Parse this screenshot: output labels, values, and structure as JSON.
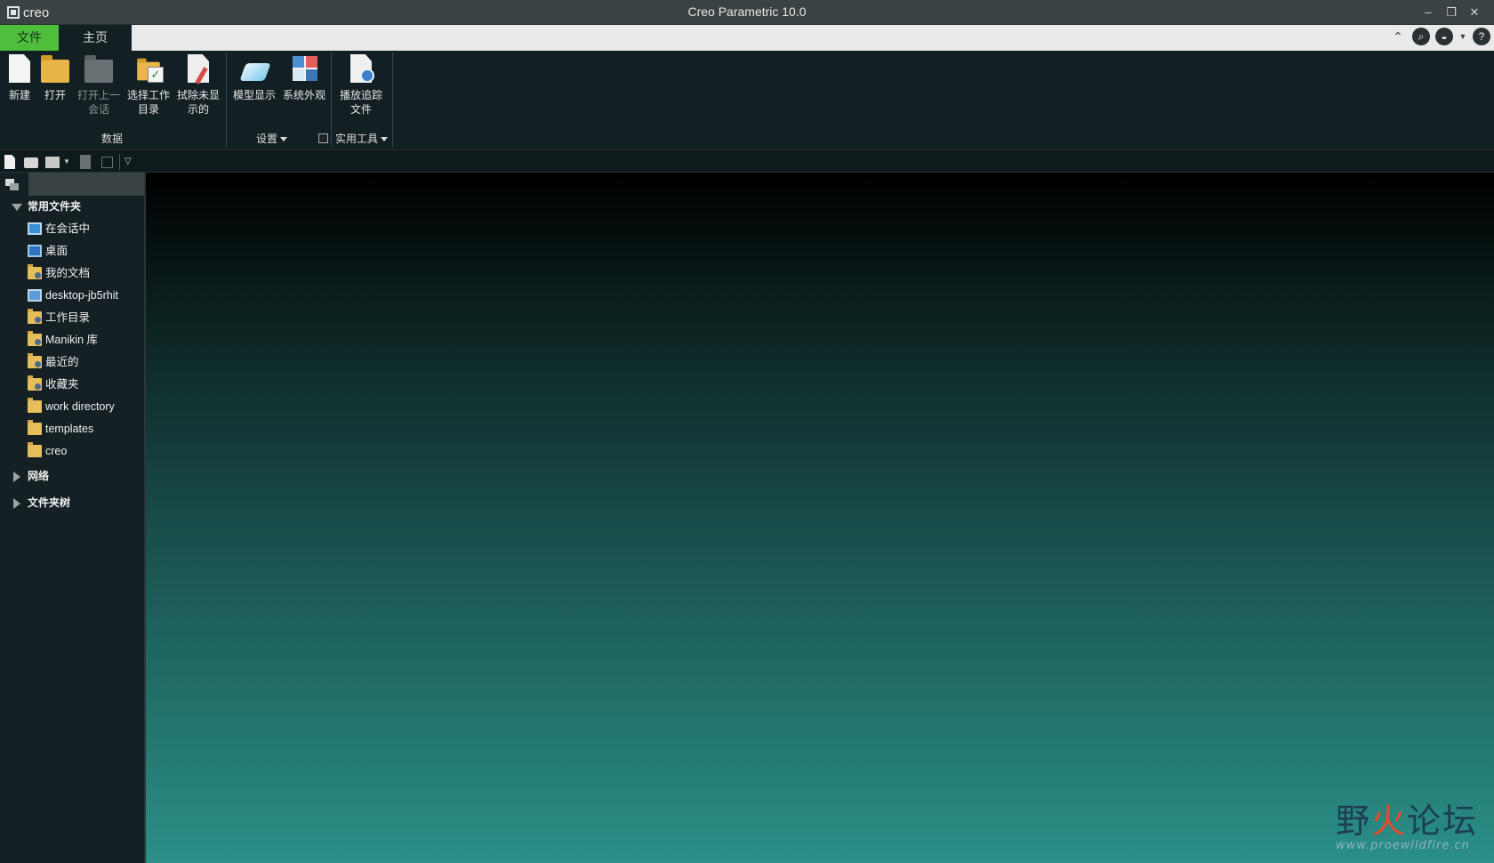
{
  "window": {
    "app_logo_text": "creo",
    "title": "Creo Parametric 10.0"
  },
  "tabs": [
    {
      "label": "文件"
    },
    {
      "label": "主页"
    }
  ],
  "ribbon": {
    "data_group": {
      "label": "数据",
      "buttons": [
        {
          "label": "新建",
          "icon": "new-document-icon"
        },
        {
          "label": "打开",
          "icon": "open-folder-icon"
        },
        {
          "label": "打开上一会话",
          "line1": "打开上一",
          "line2": "会话",
          "icon": "open-last-session-icon",
          "disabled": true
        },
        {
          "label": "选择工作目录",
          "line1": "选择工作",
          "line2": "目录",
          "icon": "select-working-directory-icon"
        },
        {
          "label": "拭除未显示的",
          "line1": "拭除未显",
          "line2": "示的",
          "icon": "erase-not-displayed-icon"
        }
      ]
    },
    "settings_group": {
      "label": "设置",
      "buttons": [
        {
          "label": "模型显示",
          "icon": "model-display-icon"
        },
        {
          "label": "系统外观",
          "icon": "system-appearance-icon"
        }
      ]
    },
    "utilities_group": {
      "label": "实用工具",
      "buttons": [
        {
          "label": "播放追踪文件",
          "line1": "播放追踪",
          "line2": "文件",
          "icon": "play-trail-file-icon"
        }
      ]
    }
  },
  "navigator": {
    "common_folders_label": "常用文件夹",
    "items": [
      {
        "label": "在会话中",
        "icon": "monitor-icon"
      },
      {
        "label": "桌面",
        "icon": "desktop-icon"
      },
      {
        "label": "我的文档",
        "icon": "my-documents-icon"
      },
      {
        "label": "desktop-jb5rhit",
        "icon": "computer-icon"
      },
      {
        "label": "工作目录",
        "icon": "working-directory-icon"
      },
      {
        "label": "Manikin 库",
        "icon": "manikin-library-icon"
      },
      {
        "label": "最近的",
        "icon": "recent-icon"
      },
      {
        "label": "收藏夹",
        "icon": "favorites-icon"
      },
      {
        "label": "work directory",
        "icon": "folder-icon"
      },
      {
        "label": "templates",
        "icon": "folder-icon"
      },
      {
        "label": "creo",
        "icon": "folder-icon"
      }
    ],
    "network_label": "网络",
    "folder_tree_label": "文件夹树"
  },
  "watermark": {
    "main_text_a": "野",
    "main_text_b": "火",
    "main_text_c": "论坛",
    "url": "www.proewildfire.cn"
  }
}
